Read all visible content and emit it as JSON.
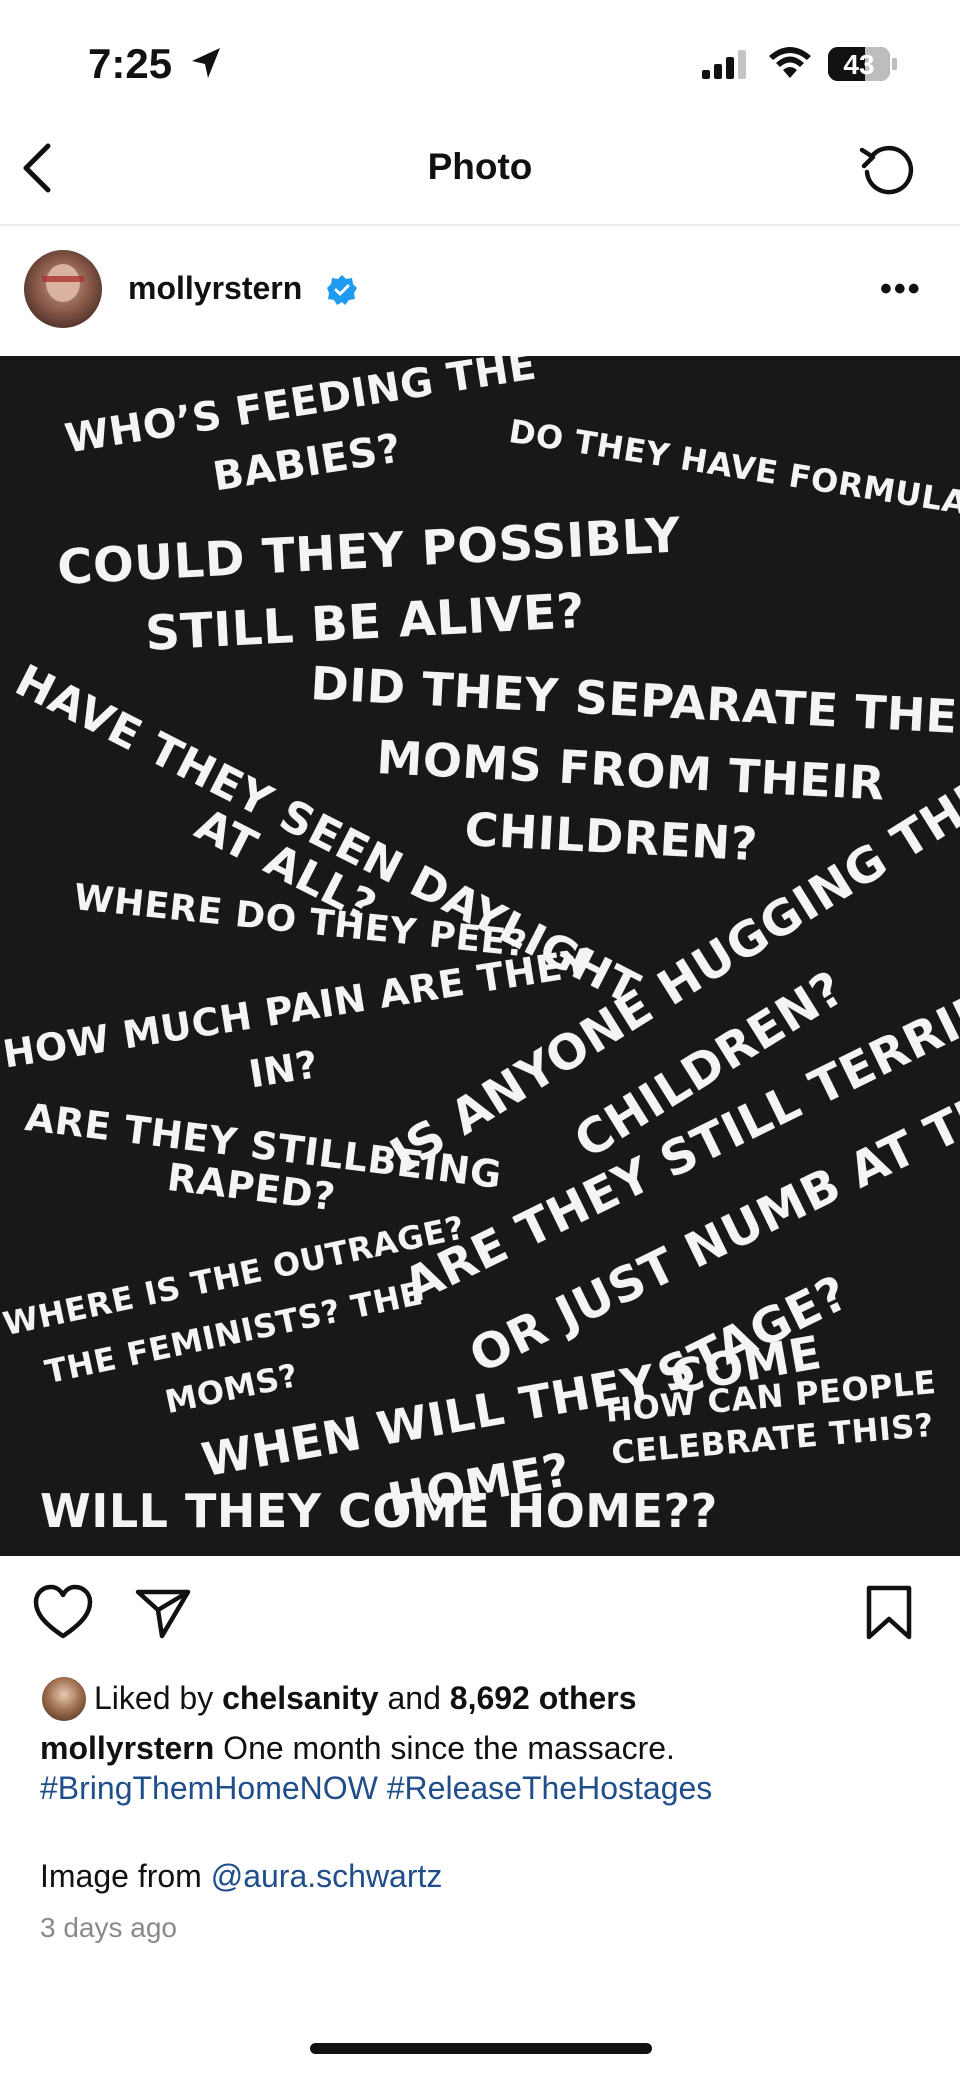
{
  "status_bar": {
    "time": "7:25",
    "battery": "43"
  },
  "nav": {
    "title": "Photo"
  },
  "post": {
    "username": "mollyrstern",
    "image_lines": [
      "WHO’S FEEDING THE",
      "BABIES?",
      "DO THEY HAVE FORMULA",
      "COULD THEY POSSIBLY",
      "STILL BE ALIVE?",
      "DID THEY SEPARATE THE",
      "MOMS FROM THEIR",
      "CHILDREN?",
      "HAVE THEY SEEN DAYLIGHT",
      "AT ALL?",
      "WHERE DO THEY PEE?",
      "HOW MUCH PAIN ARE THEY",
      "IN?",
      "IS ANYONE HUGGING THE",
      "CHILDREN?",
      "ARE THEY STILLBEING",
      "RAPED?",
      "ARE THEY STILL TERRIFIED",
      "OR JUST NUMB AT THIS",
      "STAGE?",
      "WHERE IS THE OUTRAGE?",
      "THE FEMINISTS? THE",
      "MOMS?",
      "WHEN WILL THEY COME",
      "HOME?",
      "HOW CAN PEOPLE",
      "CELEBRATE THIS?",
      "WILL THEY COME HOME??"
    ]
  },
  "likes": {
    "prefix": "Liked by ",
    "user": "chelsanity",
    "middle": " and ",
    "count": "8,692 others"
  },
  "caption": {
    "username": "mollyrstern",
    "text": " One month since the massacre.",
    "hashtag1": "#BringThemHomeNOW",
    "hashtag2": "#ReleaseTheHostages",
    "credit_prefix": "Image from ",
    "credit_handle": "@aura.schwartz"
  },
  "timestamp": "3 days ago",
  "colors": {
    "verified": "#1d9bf0",
    "link": "#1f4e8a",
    "image_bg": "#181818"
  }
}
